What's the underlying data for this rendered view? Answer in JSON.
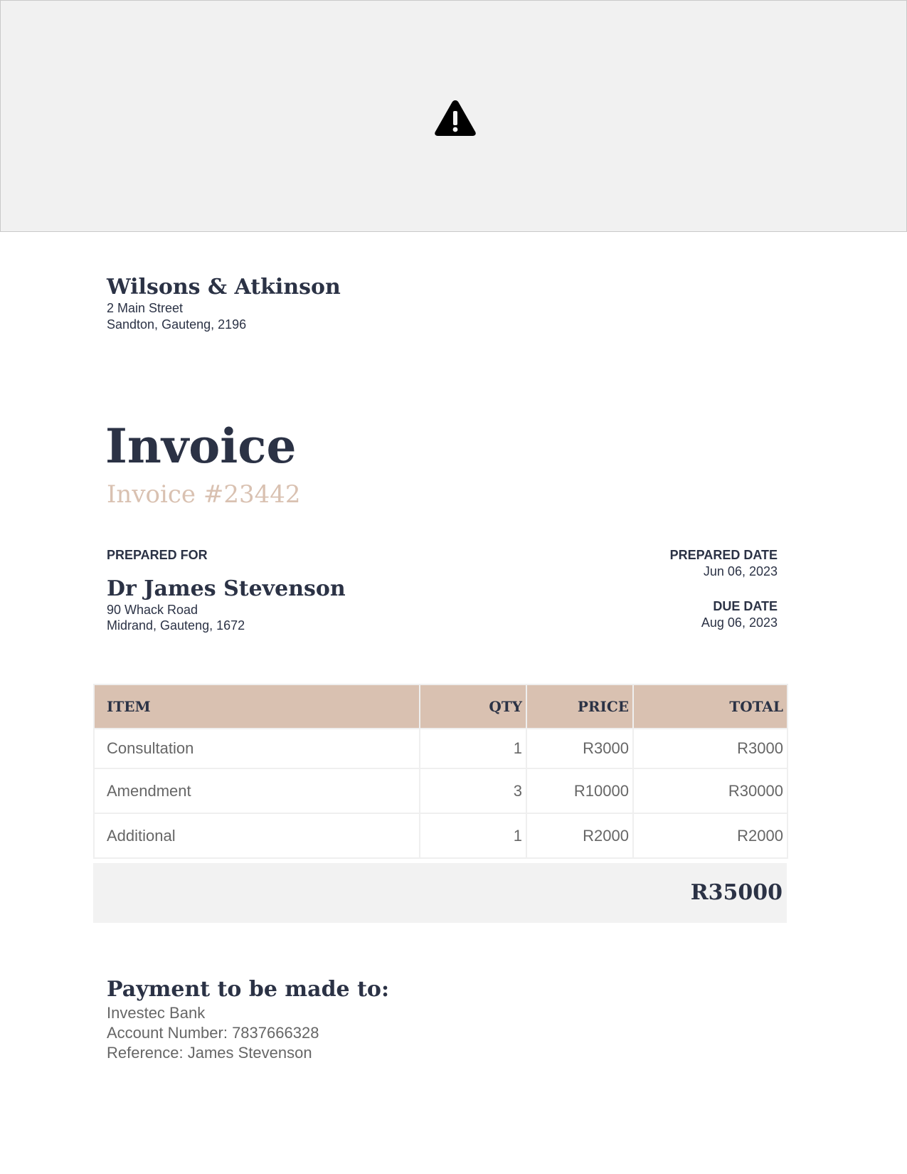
{
  "banner": {
    "icon": "warning-icon"
  },
  "company": {
    "name": "Wilsons & Atkinson",
    "address_line1": "2 Main Street",
    "address_line2": "Sandton, Gauteng, 2196"
  },
  "document": {
    "title": "Invoice",
    "invoice_number": "Invoice #23442"
  },
  "prepared_for": {
    "label": "PREPARED FOR",
    "name": "Dr James Stevenson",
    "address_line1": "90 Whack Road",
    "address_line2": "Midrand, Gauteng, 1672"
  },
  "dates": {
    "prepared_label": "PREPARED DATE",
    "prepared_value": "Jun 06, 2023",
    "due_label": "DUE DATE",
    "due_value": "Aug 06, 2023"
  },
  "table": {
    "headers": {
      "item": "ITEM",
      "qty": "QTY",
      "price": "PRICE",
      "total": "TOTAL"
    },
    "rows": [
      {
        "item": "Consultation",
        "qty": "1",
        "price": "R3000",
        "total": "R3000"
      },
      {
        "item": "Amendment",
        "qty": "3",
        "price": "R10000",
        "total": "R30000"
      },
      {
        "item": "Additional",
        "qty": "1",
        "price": "R2000",
        "total": "R2000"
      }
    ],
    "grand_total": "R35000"
  },
  "payment": {
    "title": "Payment to be made to:",
    "bank": "Investec Bank",
    "account": "Account Number: 7837666328",
    "reference": "Reference: James Stevenson"
  },
  "colors": {
    "text_dark": "#2b3245",
    "accent_tan": "#d9c1b1",
    "text_muted": "#666666",
    "panel_grey": "#f2f2f2"
  }
}
